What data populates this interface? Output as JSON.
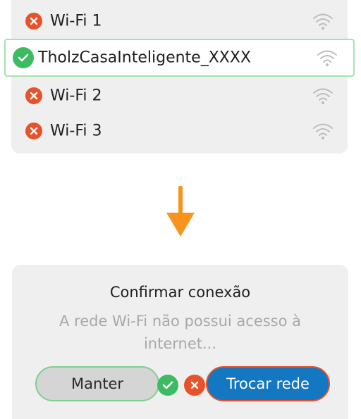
{
  "wifi_list": {
    "networks": [
      {
        "name": "Wi-Fi 1",
        "status": "error",
        "signal_icon": "wifi-icon"
      },
      {
        "name": "TholzCasaInteligente_XXXX",
        "status": "ok",
        "selected": true,
        "signal_icon": "wifi-icon"
      },
      {
        "name": "Wi-Fi 2",
        "status": "error",
        "signal_icon": "wifi-icon"
      },
      {
        "name": "Wi-Fi 3",
        "status": "error",
        "signal_icon": "wifi-icon"
      }
    ]
  },
  "transition_icon": "arrow-down-icon",
  "dialog": {
    "title": "Confirmar conexão",
    "message": "A rede Wi-Fi não possui acesso à internet...",
    "keep_label": "Manter",
    "switch_label": "Trocar rede"
  },
  "colors": {
    "panel_bg": "#efefef",
    "error": "#e8522a",
    "success": "#3dbb63",
    "selected_border": "#a6e3b0",
    "arrow": "#f7941d",
    "primary_button": "#1477c2",
    "secondary_button": "#d5d5d5",
    "muted_text": "#a8a8a8"
  }
}
